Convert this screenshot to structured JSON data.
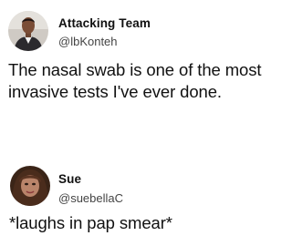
{
  "tweets": [
    {
      "name": "Attacking Team",
      "handle": "@lbKonteh",
      "text": "The nasal swab is one of the most invasive tests I've ever done."
    },
    {
      "name": "Sue",
      "handle": "@suebellaC",
      "text": "*laughs in pap smear*"
    }
  ]
}
